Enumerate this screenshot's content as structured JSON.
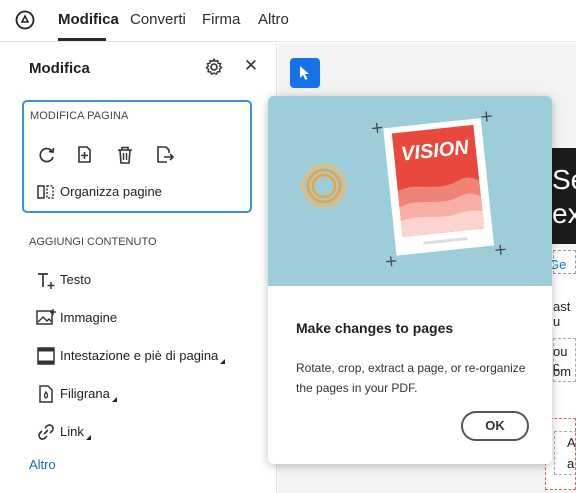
{
  "topbar": {
    "tabs": [
      {
        "label": "Modifica"
      },
      {
        "label": "Converti"
      },
      {
        "label": "Firma"
      },
      {
        "label": "Altro"
      }
    ]
  },
  "panel": {
    "title": "Modifica",
    "edit_page": {
      "label": "MODIFICA PAGINA",
      "organize_label": "Organizza pagine"
    },
    "add_content": {
      "label": "AGGIUNGI CONTENUTO",
      "items": [
        {
          "label": "Testo"
        },
        {
          "label": "Immagine"
        },
        {
          "label": "Intestazione e piè di pagina"
        },
        {
          "label": "Filigrana"
        },
        {
          "label": "Link"
        }
      ]
    },
    "more_label": "Altro"
  },
  "document": {
    "heading_line1": "Se",
    "heading_line2": "ex",
    "link_text": "Ge",
    "line_a": "ast u",
    "line_b": "ou c",
    "line_c": "om",
    "line_d": "A",
    "line_e": "a"
  },
  "popover": {
    "hero_text": "VISION",
    "title": "Make changes to pages",
    "description": "Rotate, crop, extract a page, or re-organize the pages in your PDF.",
    "ok_label": "OK"
  },
  "colors": {
    "accent_blue": "#1473e6",
    "selection_border": "#3b8fe0",
    "hero_bg": "#9ccdd9",
    "poster_red": "#e8483e"
  }
}
